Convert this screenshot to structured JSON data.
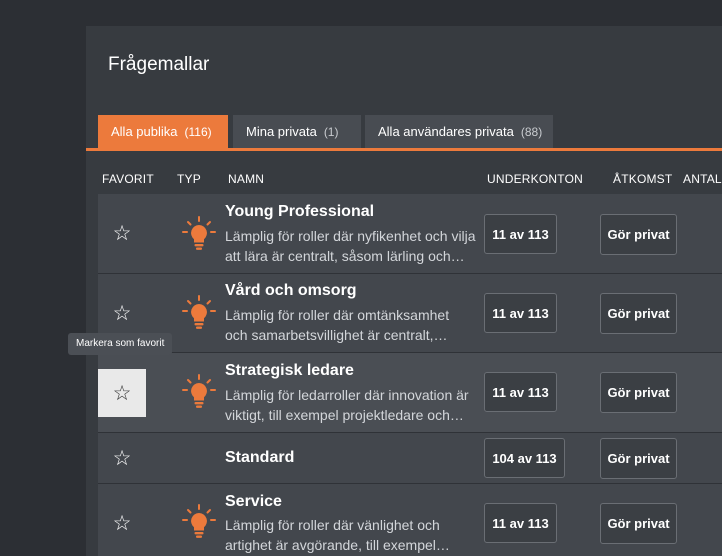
{
  "page": {
    "title": "Frågemallar"
  },
  "tabs": [
    {
      "label": "Alla publika",
      "count": "(116)",
      "active": true
    },
    {
      "label": "Mina privata",
      "count": "(1)",
      "active": false
    },
    {
      "label": "Alla användares privata",
      "count": "(88)",
      "active": false
    }
  ],
  "table": {
    "columns": [
      "FAVORIT",
      "TYP",
      "NAMN",
      "UNDERKONTON",
      "ÅTKOMST",
      "ANTAL"
    ],
    "rows": [
      {
        "name": "Young Professional",
        "desc_line1": "Lämplig för roller där nyfikenhet och vilja",
        "desc_line2": "att lära är centralt, såsom lärling och…",
        "subaccounts": "11 av 113",
        "access": "Gör privat",
        "type_icon": "lightbulb-icon"
      },
      {
        "name": "Vård och omsorg",
        "desc_line1": "Lämplig för roller där omtänksamhet",
        "desc_line2": "och samarbetsvillighet är centralt,…",
        "subaccounts": "11 av 113",
        "access": "Gör privat",
        "type_icon": "lightbulb-icon"
      },
      {
        "name": "Strategisk ledare",
        "desc_line1": "Lämplig för ledarroller där innovation är",
        "desc_line2": "viktigt, till exempel projektledare och…",
        "subaccounts": "11 av 113",
        "access": "Gör privat",
        "type_icon": "lightbulb-icon"
      },
      {
        "name": "Standard",
        "subaccounts": "104 av 113",
        "access": "Gör privat"
      },
      {
        "name": "Service",
        "desc_line1": "Lämplig för roller där vänlighet och",
        "desc_line2": "artighet är avgörande, till exempel…",
        "subaccounts": "11 av 113",
        "access": "Gör privat",
        "type_icon": "lightbulb-icon"
      }
    ]
  },
  "tooltip": {
    "text": "Markera som favorit"
  },
  "colors": {
    "accent": "#ec7a3c",
    "panel": "#373b40",
    "row": "#43474d"
  }
}
